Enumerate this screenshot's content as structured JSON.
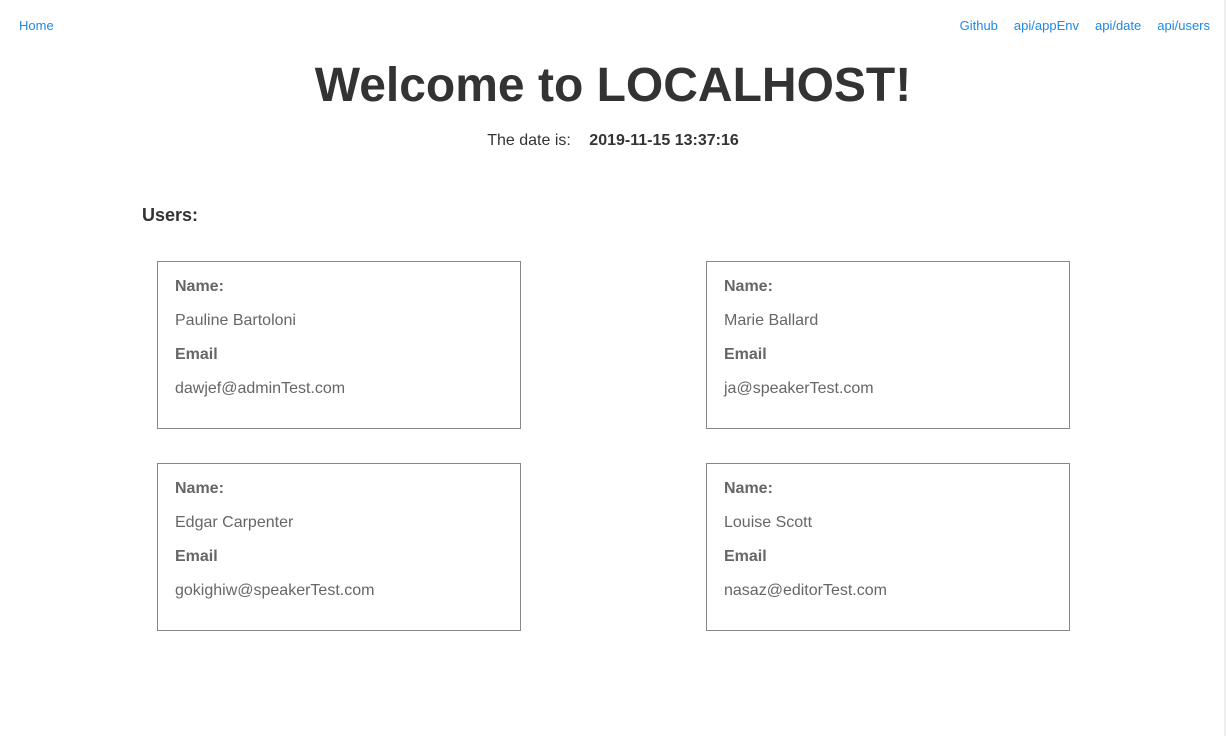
{
  "nav": {
    "home": "Home",
    "links": [
      "Github",
      "api/appEnv",
      "api/date",
      "api/users"
    ]
  },
  "header": {
    "title": "Welcome to LOCALHOST!",
    "date_label": "The date is:",
    "date_value": "2019-11-15 13:37:16"
  },
  "users": {
    "heading": "Users:",
    "name_label": "Name:",
    "email_label": "Email",
    "list": [
      {
        "name": "Pauline Bartoloni",
        "email": "dawjef@adminTest.com"
      },
      {
        "name": "Marie Ballard",
        "email": "ja@speakerTest.com"
      },
      {
        "name": "Edgar Carpenter",
        "email": "gokighiw@speakerTest.com"
      },
      {
        "name": "Louise Scott",
        "email": "nasaz@editorTest.com"
      }
    ]
  },
  "colors": {
    "link": "#1e88e5",
    "text": "#333333",
    "card_text": "#666666",
    "card_border": "#888888"
  }
}
